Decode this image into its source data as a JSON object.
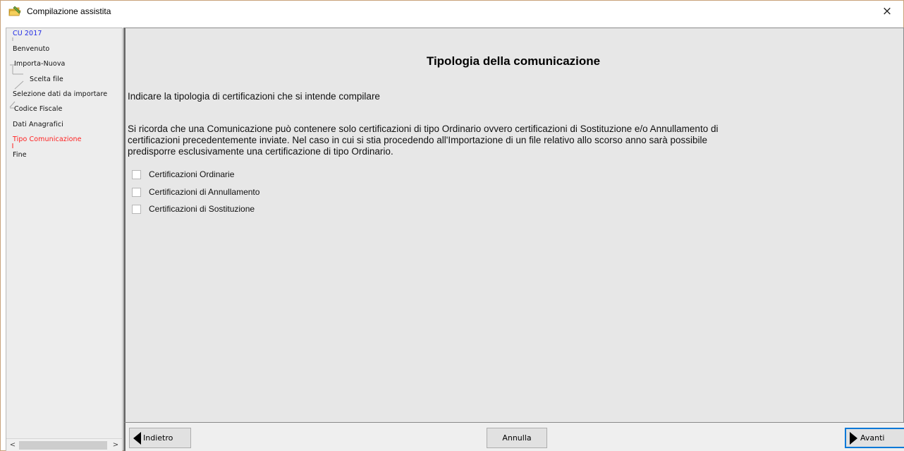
{
  "window": {
    "title": "Compilazione assistita",
    "app_icon": "folder-pencil-icon",
    "close_glyph": "×"
  },
  "sidebar": {
    "items": [
      {
        "label": "CU 2017",
        "state": "root"
      },
      {
        "label": "Benvenuto",
        "state": "normal"
      },
      {
        "label": "Importa-Nuova",
        "state": "normal"
      },
      {
        "label": "Scelta file",
        "state": "normal"
      },
      {
        "label": "Selezione dati da importare",
        "state": "normal"
      },
      {
        "label": "Codice Fiscale",
        "state": "normal"
      },
      {
        "label": "Dati Anagrafici",
        "state": "normal"
      },
      {
        "label": "Tipo Comunicazione",
        "state": "current"
      },
      {
        "label": "Fine",
        "state": "normal"
      }
    ],
    "scroll_left": "<",
    "scroll_right": ">"
  },
  "main": {
    "title": "Tipologia della comunicazione",
    "intro": "Indicare la tipologia di certificazioni che si intende compilare",
    "note_lines": [
      "Si ricorda che una Comunicazione può contenere solo certificazioni di tipo Ordinario ovvero certificazioni di Sostituzione e/o Annullamento di",
      "certificazioni precedentemente inviate. Nel caso in cui si stia procedendo all'Importazione di un file relativo allo scorso anno sarà possibile",
      "predisporre esclusivamente una certificazione di tipo Ordinario."
    ],
    "options": [
      {
        "label": "Certificazioni Ordinarie",
        "checked": false
      },
      {
        "label": "Certificazioni di Annullamento",
        "checked": false
      },
      {
        "label": "Certificazioni di Sostituzione",
        "checked": false
      }
    ]
  },
  "buttons": {
    "back": "Indietro",
    "cancel": "Annulla",
    "next": "Avanti"
  },
  "colors": {
    "root_item": "#1f2ae6",
    "current_item": "#ff2020",
    "panel_bg": "#e7e7e7",
    "default_button_border": "#0078d7"
  }
}
